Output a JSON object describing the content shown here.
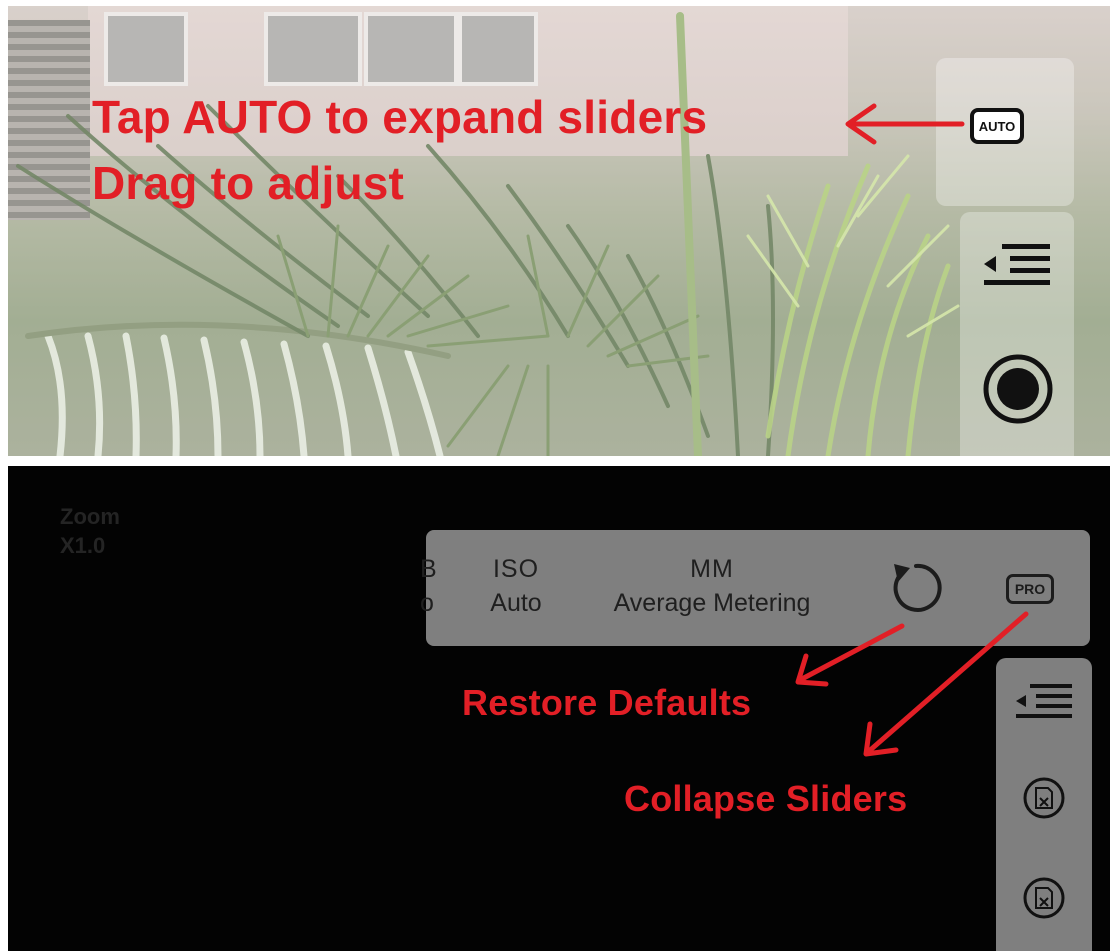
{
  "top_panel": {
    "instruction_line1": "Tap AUTO to expand sliders",
    "instruction_line2": "Drag to adjust",
    "auto_button_label": "AUTO",
    "menu_icon": "menu-collapse-icon",
    "record_icon": "record-icon"
  },
  "bottom_panel": {
    "zoom_label": "Zoom",
    "zoom_value": "X1.0",
    "params": [
      {
        "key": "B",
        "value": "o"
      },
      {
        "key": "ISO",
        "value": "Auto"
      },
      {
        "key": "MM",
        "value": "Average Metering"
      }
    ],
    "restore_icon": "restore-icon",
    "pro_button_label": "PRO",
    "restore_defaults_label": "Restore Defaults",
    "collapse_sliders_label": "Collapse Sliders",
    "menu_icon": "menu-collapse-icon",
    "sd_card_icon": "sd-card-error-icon"
  },
  "colors": {
    "annotation_red": "#e21f26",
    "panel_gray": "#7f7f7f",
    "dark_bg": "#030303"
  }
}
